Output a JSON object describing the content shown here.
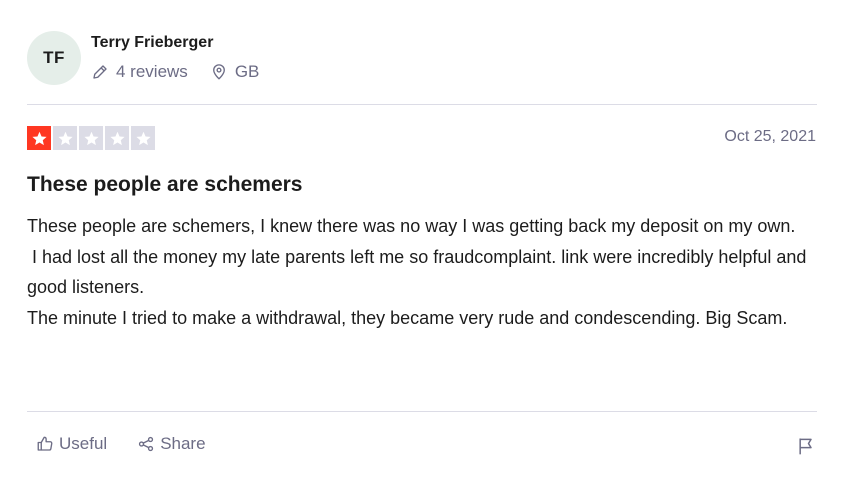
{
  "reviewer": {
    "initials": "TF",
    "name": "Terry Frieberger",
    "reviews_count": "4 reviews",
    "country": "GB"
  },
  "review": {
    "rating": 1,
    "rating_max": 5,
    "date": "Oct 25, 2021",
    "title": "These people are schemers",
    "paragraphs": [
      "These people are schemers, I knew there was no way I was getting back my deposit on my own.",
      " I had lost all the money my late parents left me so fraudcomplaint. link were incredibly helpful and good listeners.",
      "The minute I tried to make a withdrawal, they became very rude and condescending. Big Scam."
    ]
  },
  "actions": {
    "useful_label": "Useful",
    "share_label": "Share"
  },
  "colors": {
    "star_active": "#ff3722",
    "star_inactive": "#dcdce6",
    "muted_text": "#6c6c85",
    "avatar_bg": "#e5eee9"
  },
  "icons": {
    "reviews": "pencil-icon",
    "location": "location-pin-icon",
    "useful": "thumbs-up-icon",
    "share": "share-icon",
    "report": "flag-icon",
    "star": "star-icon"
  }
}
